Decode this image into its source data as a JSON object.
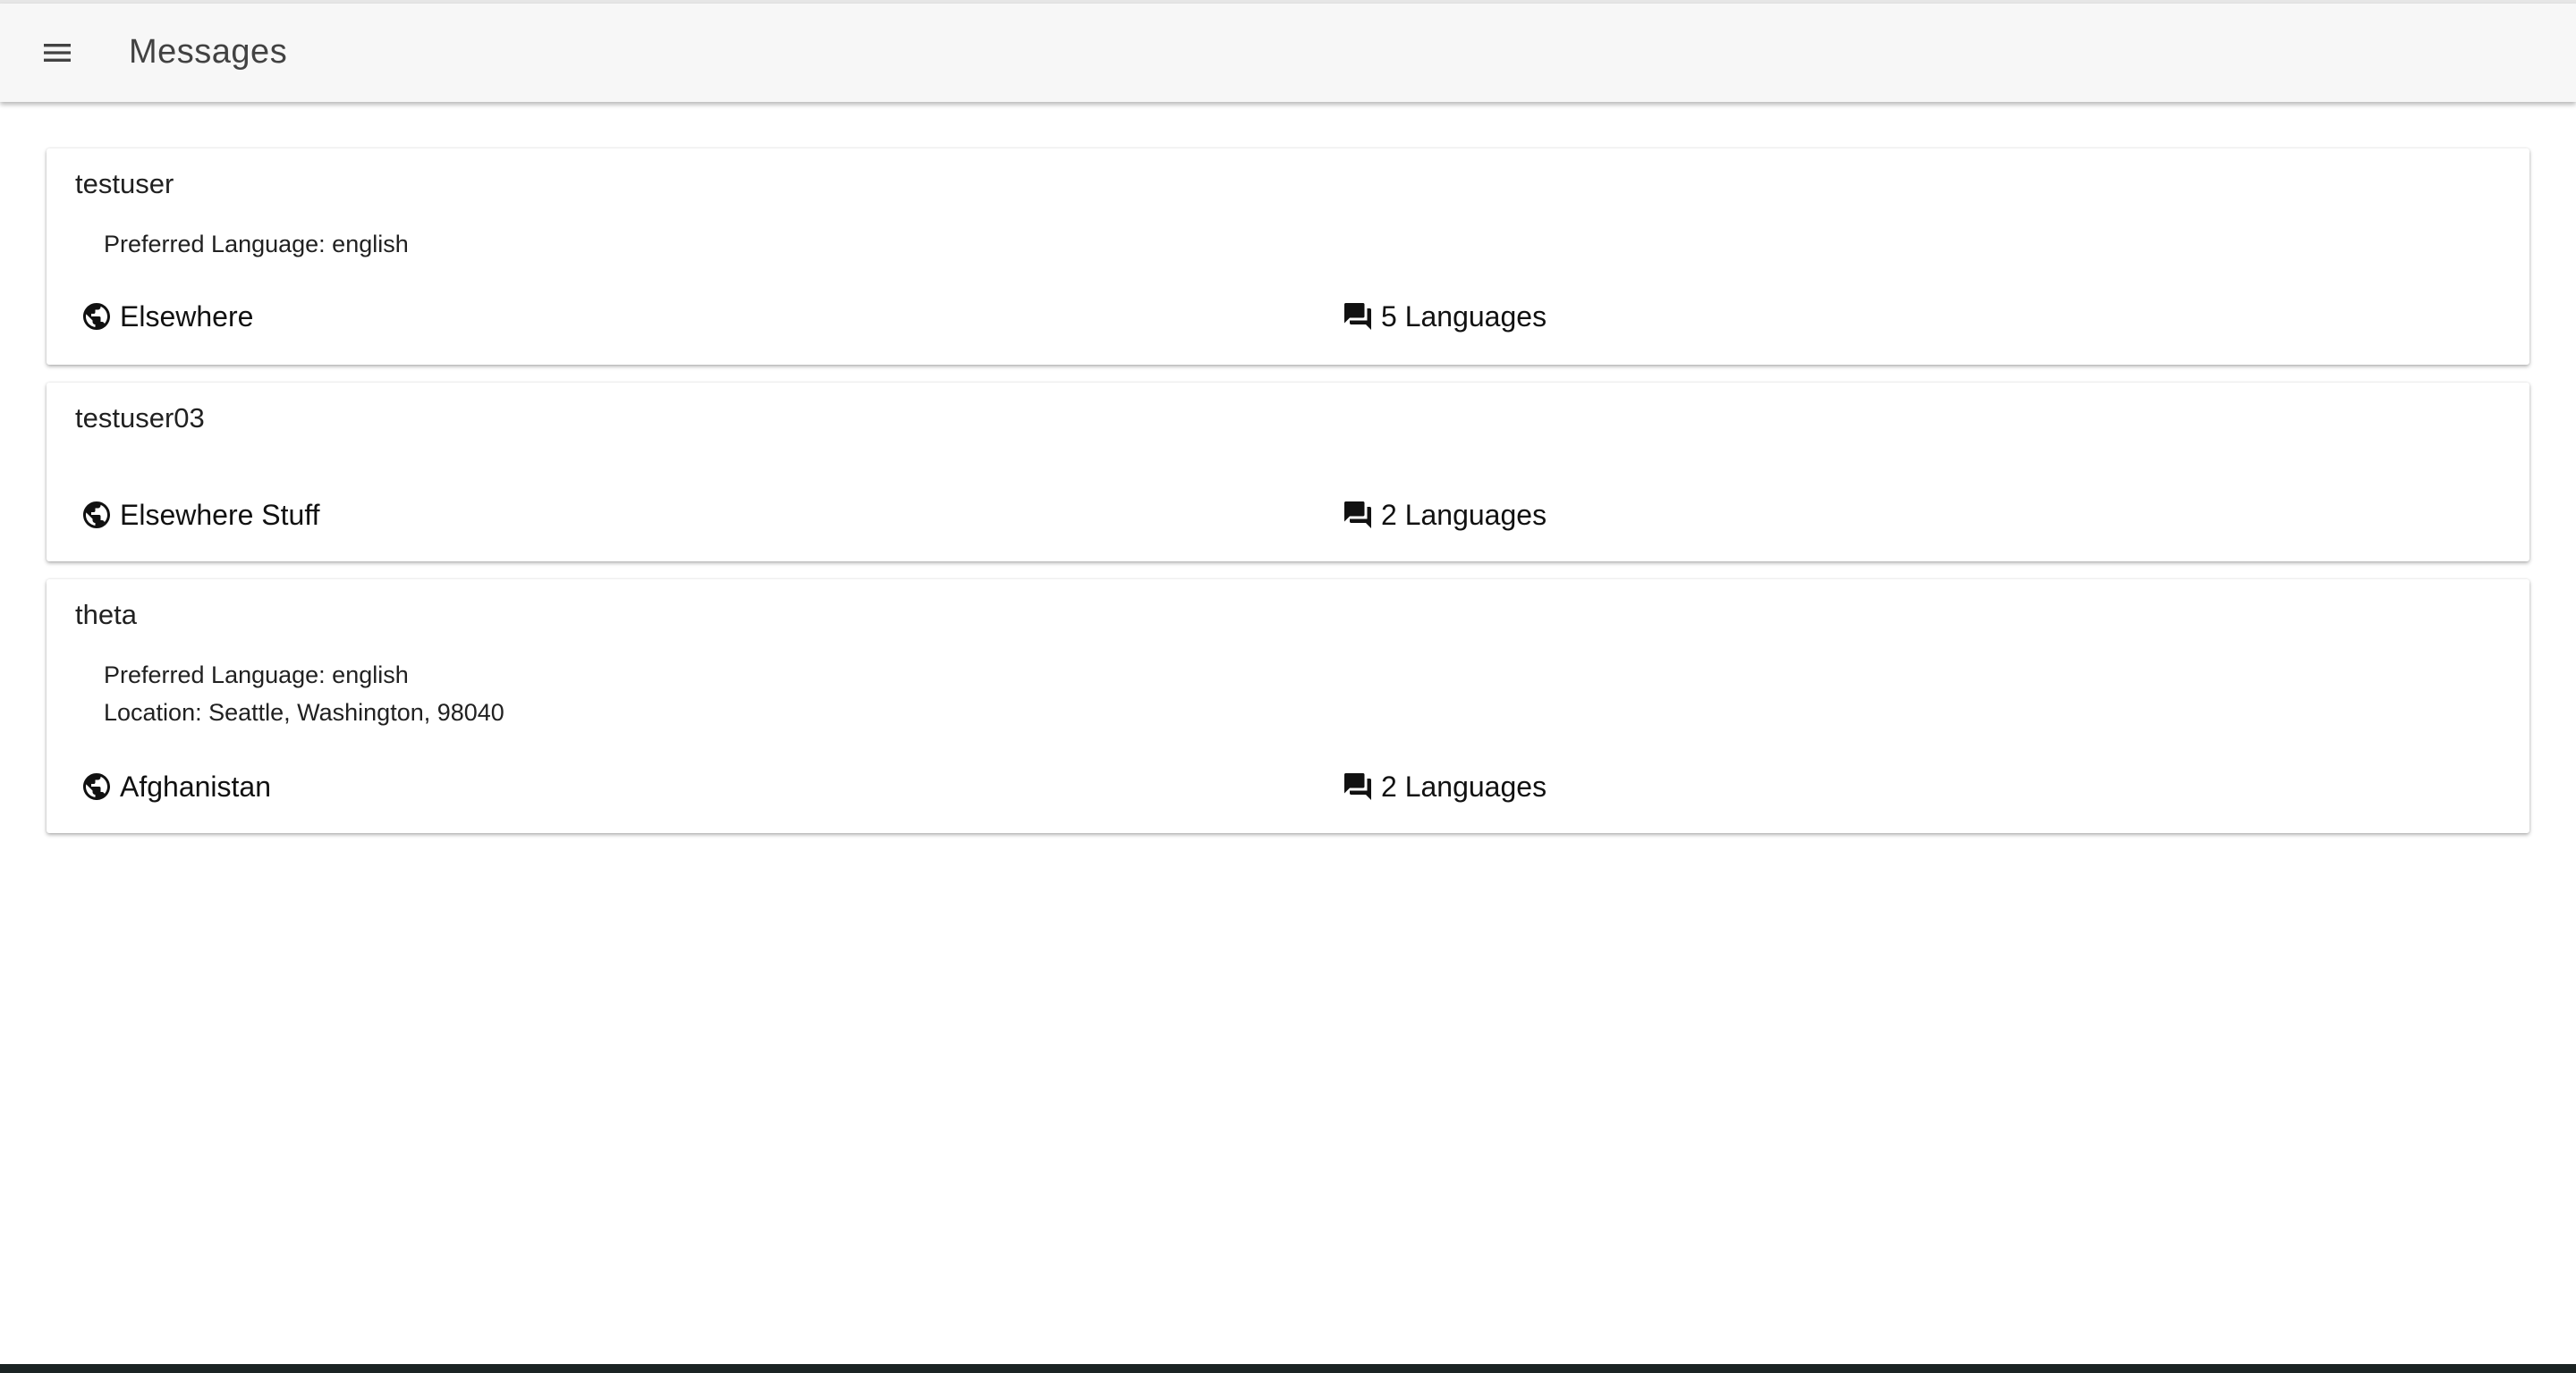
{
  "app_bar": {
    "title": "Messages",
    "menu_icon": "hamburger-menu-icon"
  },
  "cards": [
    {
      "username": "testuser",
      "details": [
        "Preferred Language: english"
      ],
      "location": "Elsewhere",
      "location_icon": "globe-icon",
      "languages": "5 Languages",
      "languages_icon": "chat-bubbles-icon"
    },
    {
      "username": "testuser03",
      "details": [],
      "location": "Elsewhere Stuff",
      "location_icon": "globe-icon",
      "languages": "2 Languages",
      "languages_icon": "chat-bubbles-icon"
    },
    {
      "username": "theta",
      "details": [
        "Preferred Language: english",
        "Location: Seattle, Washington, 98040"
      ],
      "location": "Afghanistan",
      "location_icon": "globe-icon",
      "languages": "2 Languages",
      "languages_icon": "chat-bubbles-icon"
    }
  ]
}
